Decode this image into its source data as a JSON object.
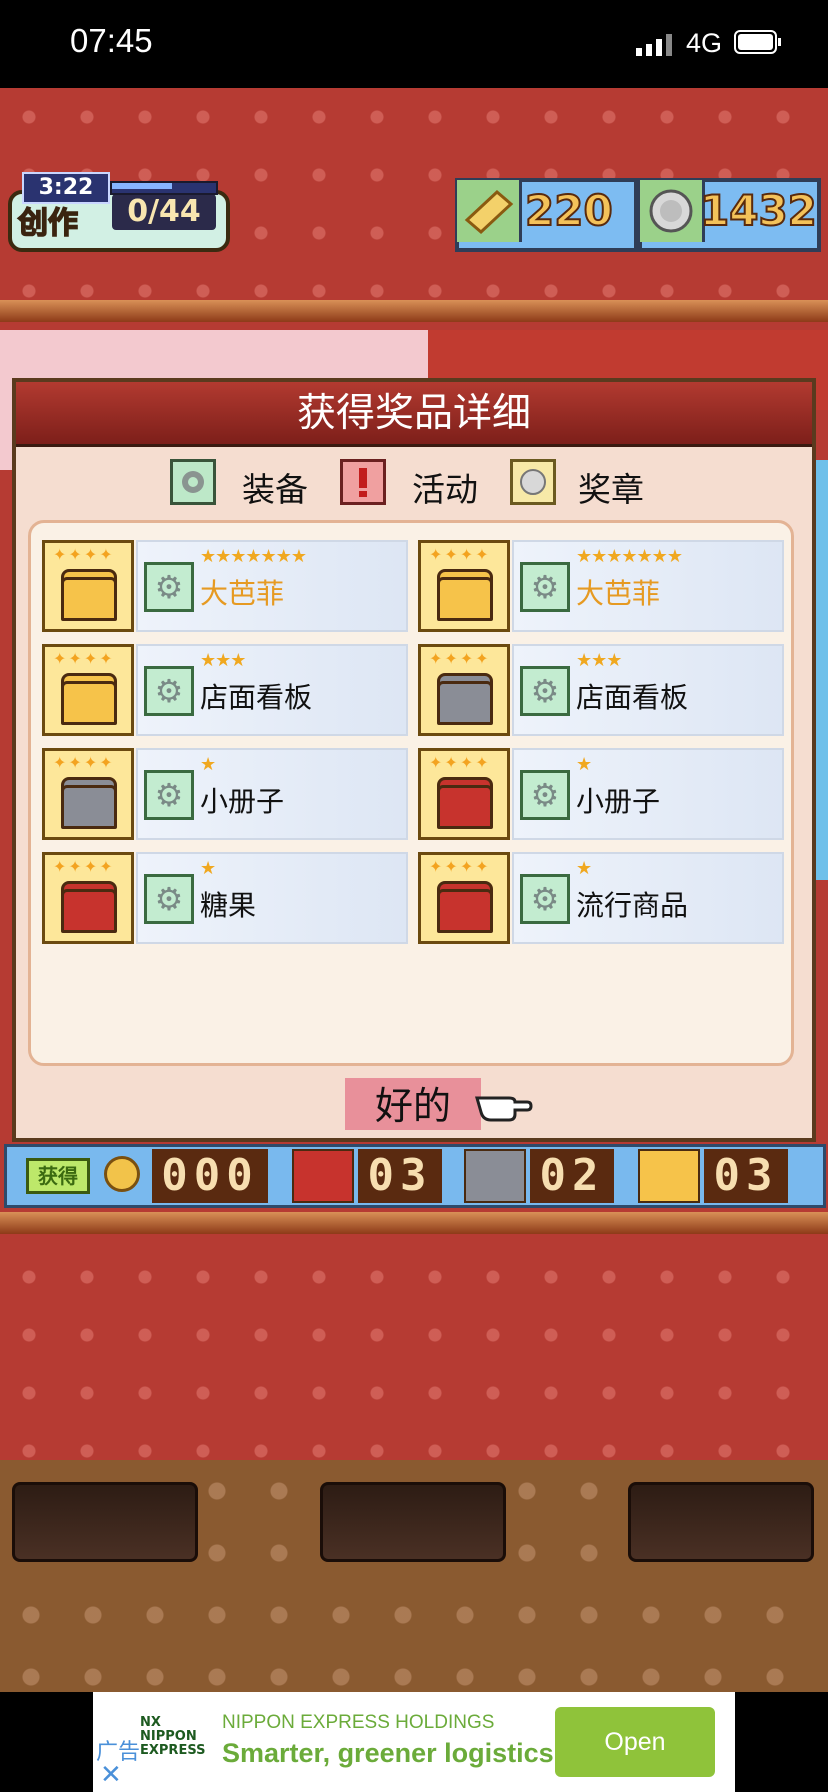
{
  "status_bar": {
    "time": "07:45",
    "network": "4G"
  },
  "hud": {
    "create_label": "创作",
    "create_count": "0/44",
    "create_timer": "3:22",
    "create_progress": 0.6,
    "tickets": "220",
    "coins": "1432"
  },
  "modal": {
    "title": "获得奖品详细",
    "legend": {
      "equip": "装备",
      "event": "活动",
      "medal": "奖章"
    },
    "prizes": [
      {
        "name": "大芭菲",
        "stars": "★★★★★★★",
        "chest": "gold",
        "highlight": true
      },
      {
        "name": "大芭菲",
        "stars": "★★★★★★★",
        "chest": "gold",
        "highlight": true
      },
      {
        "name": "店面看板",
        "stars": "★★★",
        "chest": "gold",
        "highlight": false
      },
      {
        "name": "店面看板",
        "stars": "★★★",
        "chest": "silver",
        "highlight": false
      },
      {
        "name": "小册子",
        "stars": "★",
        "chest": "silver",
        "highlight": false
      },
      {
        "name": "小册子",
        "stars": "★",
        "chest": "red",
        "highlight": false
      },
      {
        "name": "糖果",
        "stars": "★",
        "chest": "red",
        "highlight": false
      },
      {
        "name": "流行商品",
        "stars": "★",
        "chest": "red",
        "highlight": false
      }
    ],
    "ok_label": "好的"
  },
  "counters": {
    "get_label": "获得",
    "coin_count": "000",
    "red_count": "03",
    "silver_count": "02",
    "gold_count": "03"
  },
  "ad": {
    "tag": "广告",
    "logo": "NX NIPPON EXPRESS",
    "company": "NIPPON EXPRESS HOLDINGS",
    "headline": "Smarter, greener logistics",
    "button": "Open"
  },
  "colors": {
    "gold_chest": "#f6c34a",
    "silver_chest": "#8a8d96",
    "red_chest": "#c7332d",
    "highlight_name": "#e69a22"
  }
}
